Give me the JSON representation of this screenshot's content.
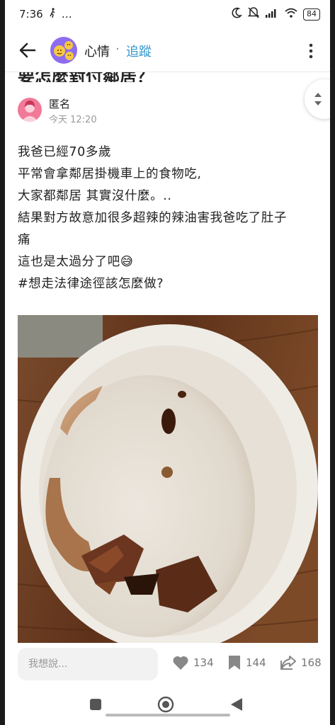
{
  "status_bar": {
    "time": "7:36",
    "extra": "…",
    "battery": "84"
  },
  "header": {
    "forum_name": "心情",
    "separator": "·",
    "follow_label": "追蹤"
  },
  "post": {
    "title": "要怎麼對付鄰居？",
    "author": "匿名",
    "time": "今天 12:20",
    "lines": [
      "我爸已經70多歲",
      "平常會拿鄰居掛機車上的食物吃,",
      "大家都鄰居 其實沒什麼。..",
      "結果對方故意加很多超辣的辣油害我爸吃了肚子",
      "痛",
      "這也是太過分了吧😅",
      "#想走法律途徑該怎麼做?"
    ]
  },
  "actions": {
    "comment_placeholder": "我想說...",
    "likes": "134",
    "bookmarks": "144",
    "shares": "168"
  },
  "icons": {
    "back": "back-arrow-icon",
    "more": "more-vertical-icon",
    "like": "heart-icon",
    "bookmark": "bookmark-icon",
    "share": "share-icon"
  },
  "colors": {
    "follow": "#3397cf",
    "forum_avatar": "#8e6cf0",
    "author_avatar": "#f07a98",
    "muted_text": "#999999"
  }
}
